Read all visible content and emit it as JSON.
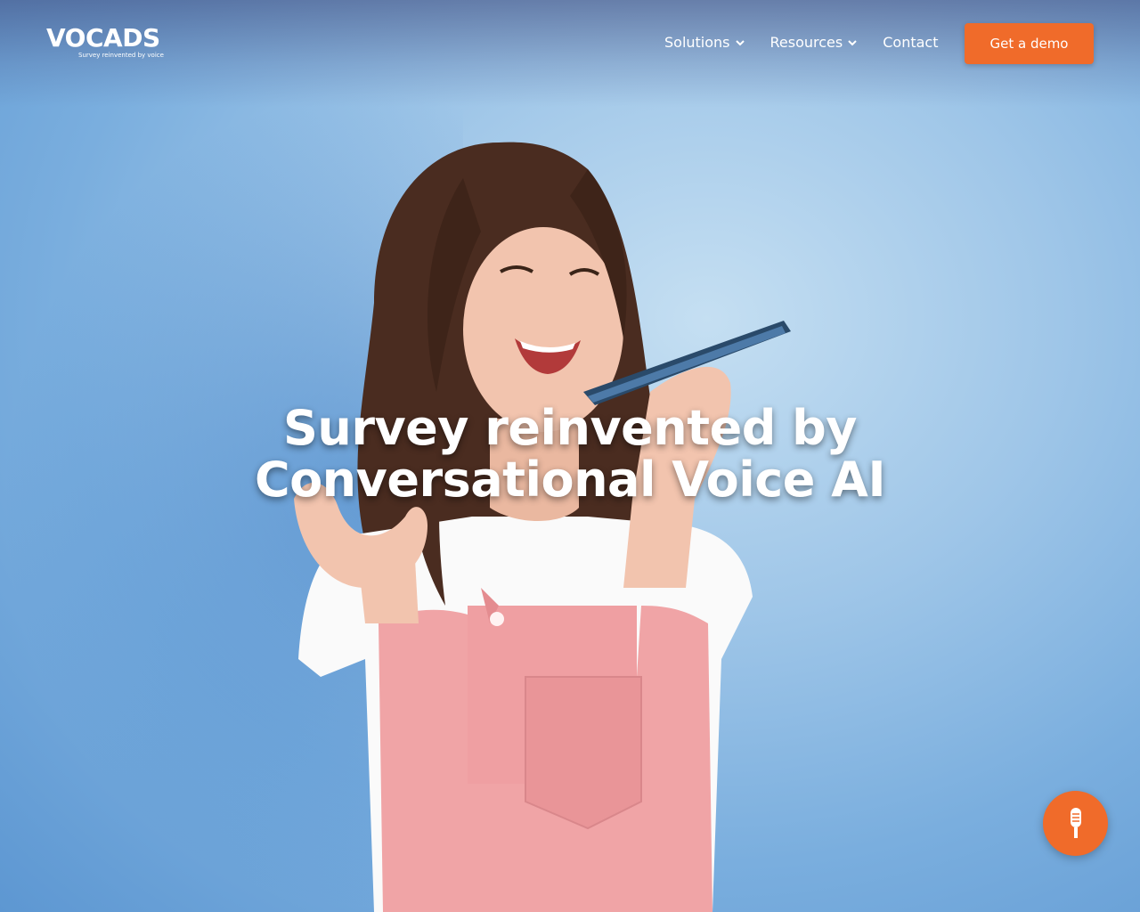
{
  "brand": {
    "name": "VOCADS",
    "tagline": "Survey reinvented by voice"
  },
  "nav": {
    "items": [
      {
        "label": "Solutions",
        "has_dropdown": true
      },
      {
        "label": "Resources",
        "has_dropdown": true
      },
      {
        "label": "Contact",
        "has_dropdown": false
      }
    ],
    "cta_label": "Get a demo"
  },
  "hero": {
    "title_line1": "Survey reinvented by",
    "title_line2": "Conversational Voice AI"
  },
  "widget": {
    "icon": "microphone-icon"
  },
  "colors": {
    "accent": "#f06b2a",
    "background": "#9fc6e8",
    "text": "#ffffff"
  }
}
